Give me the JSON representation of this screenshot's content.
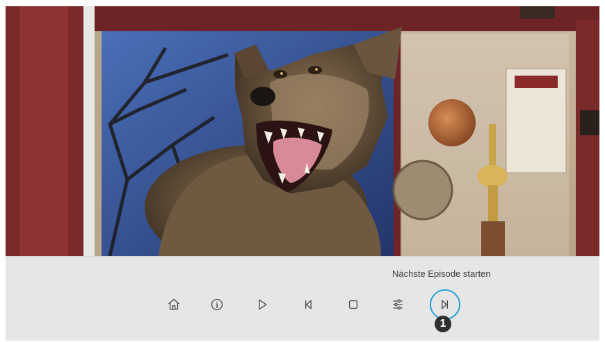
{
  "player": {
    "hint_text": "Nächste Episode starten",
    "focus_color": "#2a9fd8",
    "badge_number": "1"
  },
  "controls": [
    {
      "name": "home-button",
      "icon": "home-icon"
    },
    {
      "name": "info-button",
      "icon": "info-icon"
    },
    {
      "name": "play-button",
      "icon": "play-icon"
    },
    {
      "name": "previous-button",
      "icon": "skip-back-icon"
    },
    {
      "name": "stop-button",
      "icon": "stop-icon"
    },
    {
      "name": "settings-button",
      "icon": "sliders-icon"
    },
    {
      "name": "next-episode-button",
      "icon": "skip-forward-icon"
    }
  ]
}
